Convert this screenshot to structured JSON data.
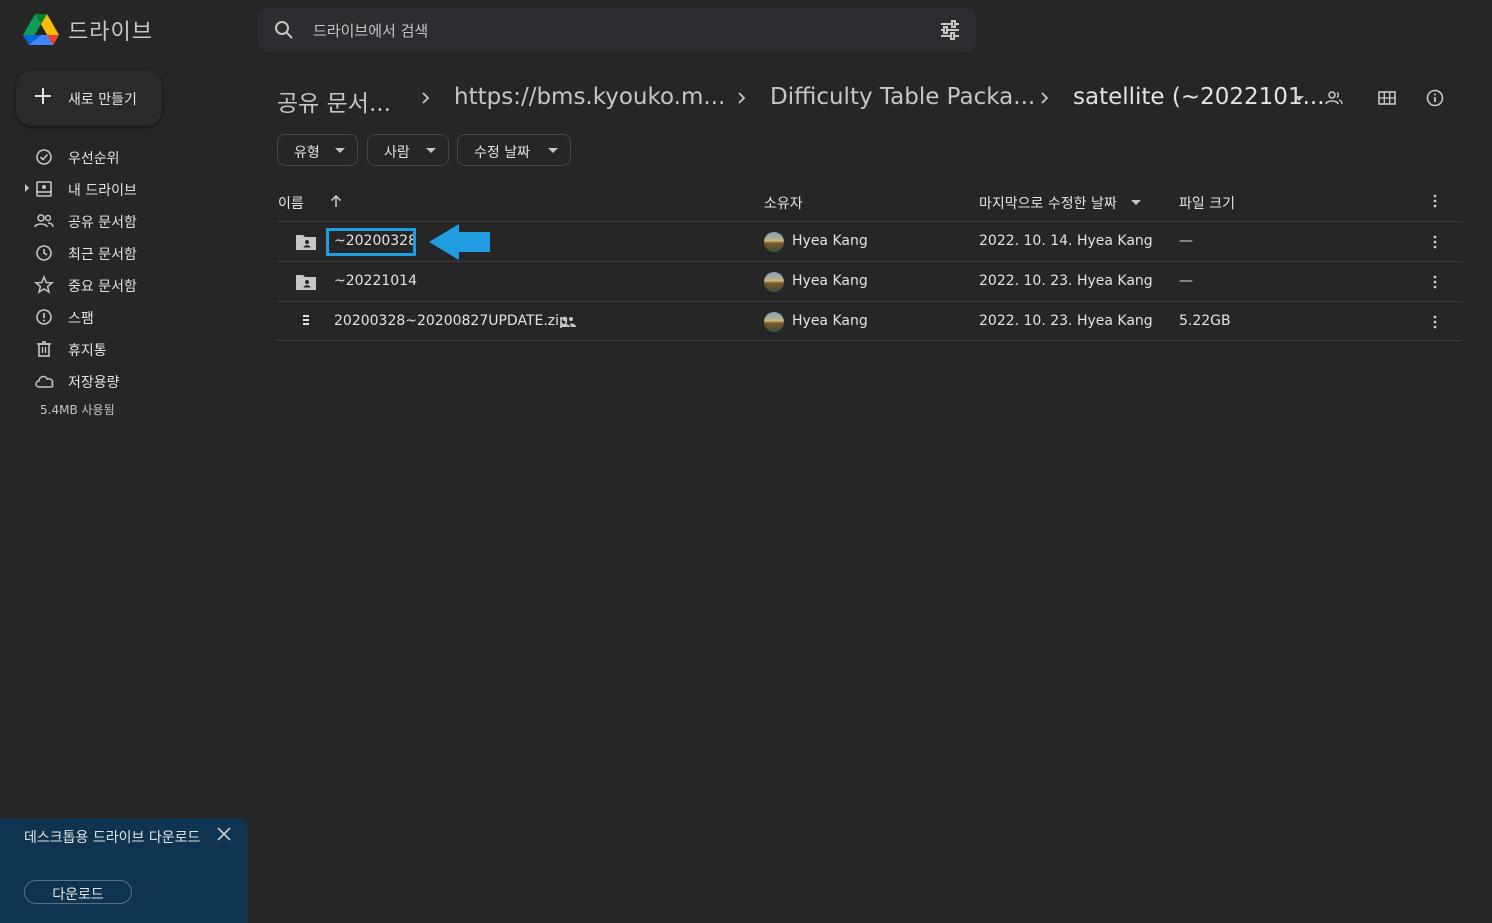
{
  "app": {
    "title": "드라이브",
    "accent_color": "#1f9de0"
  },
  "search": {
    "placeholder": "드라이브에서 검색"
  },
  "new_button": {
    "label": "새로 만들기"
  },
  "sidebar": {
    "items": [
      {
        "label": "우선순위",
        "icon": "priority-icon"
      },
      {
        "label": "내 드라이브",
        "icon": "my-drive-icon"
      },
      {
        "label": "공유 문서함",
        "icon": "shared-icon"
      },
      {
        "label": "최근 문서함",
        "icon": "clock-icon"
      },
      {
        "label": "중요 문서함",
        "icon": "star-icon"
      },
      {
        "label": "스팸",
        "icon": "spam-icon"
      },
      {
        "label": "휴지통",
        "icon": "trash-icon"
      },
      {
        "label": "저장용량",
        "icon": "cloud-icon"
      }
    ],
    "storage_used": "5.4MB 사용됨"
  },
  "breadcrumb": {
    "items": [
      "공유 문서...",
      "https://bms.kyouko.m...",
      "Difficulty Table Packa...",
      "satellite (~2022101..."
    ]
  },
  "filters": {
    "type": "유형",
    "people": "사람",
    "modified": "수정 날짜"
  },
  "table": {
    "headers": {
      "name": "이름",
      "owner": "소유자",
      "modified": "마지막으로 수정한 날짜",
      "size": "파일 크기"
    },
    "rows": [
      {
        "name": "~20200328",
        "type": "shared-folder",
        "owner": "Hyea Kang",
        "modified": "2022. 10. 14. Hyea Kang",
        "size": "—",
        "shared": false
      },
      {
        "name": "~20221014",
        "type": "shared-folder",
        "owner": "Hyea Kang",
        "modified": "2022. 10. 23. Hyea Kang",
        "size": "—",
        "shared": false
      },
      {
        "name": "20200328~20200827UPDATE.zip",
        "type": "zip-file",
        "owner": "Hyea Kang",
        "modified": "2022. 10. 23. Hyea Kang",
        "size": "5.22GB",
        "shared": true
      }
    ]
  },
  "toast": {
    "message": "데스크톱용 드라이브 다운로드",
    "button": "다운로드"
  }
}
